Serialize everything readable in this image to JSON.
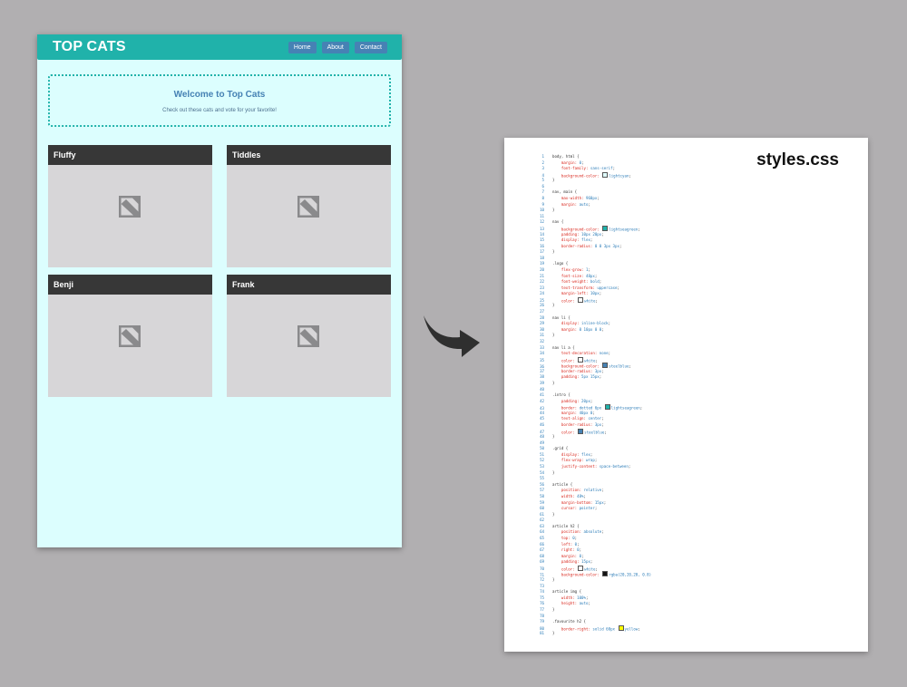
{
  "site": {
    "logo": "Top Cats",
    "nav": [
      "Home",
      "About",
      "Contact"
    ],
    "intro_title": "Welcome to Top Cats",
    "intro_text": "Check out these cats and vote for your favorite!",
    "cats": [
      "Fluffy",
      "Tiddles",
      "Benji",
      "Frank"
    ]
  },
  "sheet": {
    "title": "styles.css",
    "lines": [
      "body, html {",
      "    margin: 0;",
      "    font-family: sans-serif;",
      "    background-color: lightcyan;",
      "}",
      "",
      "nav, main {",
      "    max-width: 960px;",
      "    margin: auto;",
      "}",
      "",
      "nav {",
      "    background-color: lightseagreen;",
      "    padding: 10px 20px;",
      "    display: flex;",
      "    border-radius: 0 0 3px 3px;",
      "}",
      "",
      ".logo {",
      "    flex-grow: 1;",
      "    font-size: 48px;",
      "    font-weight: bold;",
      "    text-transform: uppercase;",
      "    margin-left: 10px;",
      "    color: white;",
      "}",
      "",
      "nav li {",
      "    display: inline-block;",
      "    margin: 0 10px 0 0;",
      "}",
      "",
      "nav li a {",
      "    text-decoration: none;",
      "    color: white;",
      "    background-color: steelblue;",
      "    border-radius: 3px;",
      "    padding: 5px 15px;",
      "}",
      "",
      ".intro {",
      "    padding: 20px;",
      "    border: dotted 6px lightseagreen;",
      "    margin: 40px 0;",
      "    text-align: center;",
      "    border-radius: 3px;",
      "    color: steelblue;",
      "}",
      "",
      ".grid {",
      "    display: flex;",
      "    flex-wrap: wrap;",
      "    justify-content: space-between;",
      "}",
      "",
      "article {",
      "    position: relative;",
      "    width: 48%;",
      "    margin-bottom: 15px;",
      "    cursor: pointer;",
      "}",
      "",
      "article h2 {",
      "    position: absolute;",
      "    top: 0;",
      "    left: 0;",
      "    right: 0;",
      "    margin: 0;",
      "    padding: 15px;",
      "    color: white;",
      "    background-color: rgba(20,20,20, 0.8)",
      "}",
      "",
      "article img {",
      "    width: 100%;",
      "    height: auto;",
      "}",
      "",
      ".favourite h2 {",
      "    border-right: solid 60px yellow;",
      "}"
    ],
    "swatches": {
      "lightcyan": "#e0ffff",
      "lightseagreen": "#20b2aa",
      "white": "#ffffff",
      "steelblue": "#4682b4",
      "rgba(20,20,20, 0.8)": "#141414",
      "yellow": "#ffff00"
    }
  },
  "colors": {
    "background": "#b1afb1",
    "page": "#dcfefe",
    "nav": "#20b2aa",
    "button": "#4682b4",
    "card_header": "#141414",
    "image_placeholder": "#d7d6d8",
    "arrow": "#2f2f2f"
  },
  "icons": {
    "image_placeholder": "broken-image-icon",
    "arrow": "curved-arrow-icon"
  }
}
